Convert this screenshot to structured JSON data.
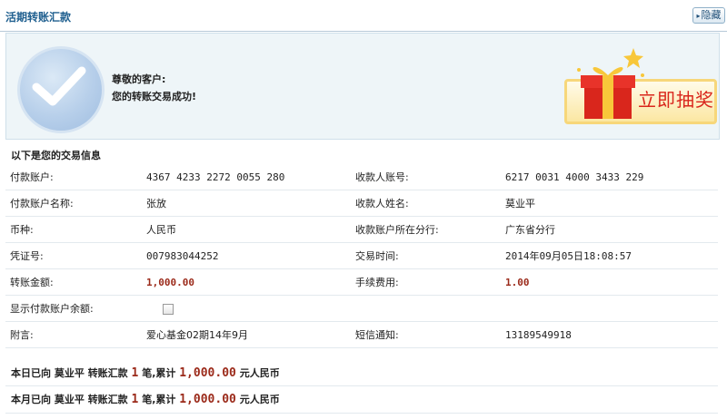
{
  "header": {
    "title": "活期转账汇款",
    "hide_label": "隐藏"
  },
  "banner": {
    "greeting": "尊敬的客户:",
    "message": "您的转账交易成功!",
    "lottery_label": "立即抽奖"
  },
  "section_title": "以下是您的交易信息",
  "rows": [
    {
      "label": "付款账户:",
      "value": "4367 4233 2272 0055 280",
      "label2": "收款人账号:",
      "value2": "6217 0031 4000 3433 229"
    },
    {
      "label": "付款账户名称:",
      "value": "张放",
      "label2": "收款人姓名:",
      "value2": "莫业平"
    },
    {
      "label": "币种:",
      "value": "人民币",
      "label2": "收款账户所在分行:",
      "value2": "广东省分行"
    },
    {
      "label": "凭证号:",
      "value": "007983044252",
      "label2": "交易时间:",
      "value2": "2014年09月05日18:08:57"
    },
    {
      "label": "转账金额:",
      "value": "1,000.00",
      "label2": "手续费用:",
      "value2": "1.00"
    },
    {
      "label": "显示付款账户余额:"
    },
    {
      "label": "附言:",
      "value": "爱心基金02期14年9月",
      "label2": "短信通知:",
      "value2": "13189549918"
    }
  ],
  "summary": [
    {
      "prefix": "本日已向",
      "name": "莫业平",
      "mid": "转账汇款",
      "count": "1",
      "unit": "笔,累计",
      "amount": "1,000.00",
      "currency": "元人民币"
    },
    {
      "prefix": "本月已向",
      "name": "莫业平",
      "mid": "转账汇款",
      "count": "1",
      "unit": "笔,累计",
      "amount": "1,000.00",
      "currency": "元人民币"
    }
  ],
  "colors": {
    "accent": "#1f5f8f",
    "amount": "#9b2a1a",
    "lottery_red": "#d9261c"
  }
}
